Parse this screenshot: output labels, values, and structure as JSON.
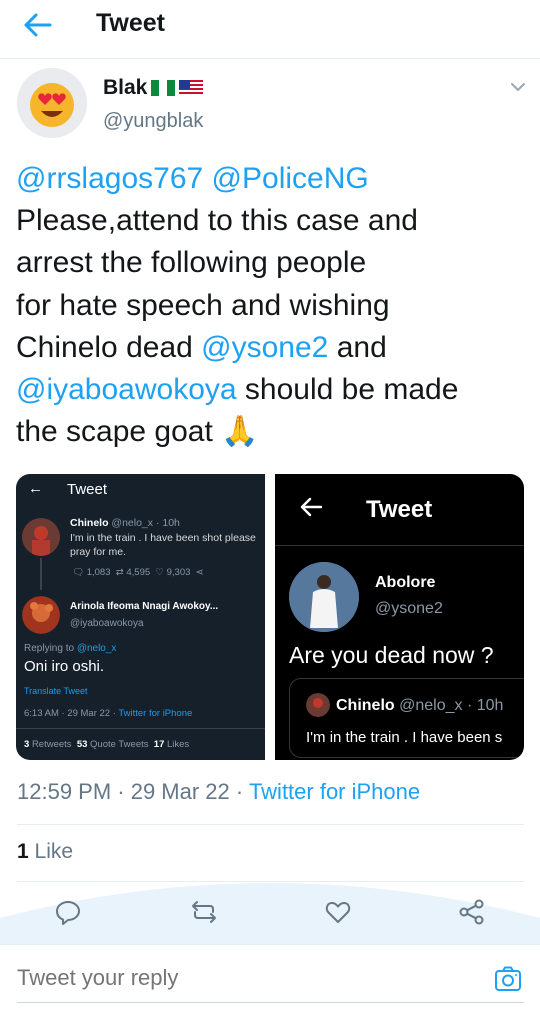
{
  "header": {
    "title": "Tweet"
  },
  "author": {
    "name": "Blak",
    "handle": "@yungblak",
    "avatar_emoji": "😍"
  },
  "tweet": {
    "lines": [
      [
        {
          "t": "@rrslagos767 @PoliceNG",
          "m": true
        }
      ],
      [
        {
          "t": "Please,attend to this case and",
          "m": false
        }
      ],
      [
        {
          "t": "arrest the following  people",
          "m": false
        }
      ],
      [
        {
          "t": "for hate speech and wishing",
          "m": false
        }
      ],
      [
        {
          "t": "Chinelo dead ",
          "m": false
        },
        {
          "t": "@ysone2",
          "m": true
        },
        {
          "t": " and",
          "m": false
        }
      ],
      [
        {
          "t": "@iyaboawokoya",
          "m": true
        },
        {
          "t": " should be made",
          "m": false
        }
      ],
      [
        {
          "t": "the scape goat ",
          "m": false
        },
        {
          "t": "🙏",
          "m": false
        }
      ]
    ]
  },
  "media_left": {
    "title": "Tweet",
    "original": {
      "name": "Chinelo",
      "handle": "@nelo_x",
      "age": "10h",
      "text_line1": "I'm in the train .  I have been shot please",
      "text_line2": "pray for me.",
      "replies": "1,083",
      "retweets": "4,595",
      "likes": "9,303"
    },
    "reply": {
      "name": "Arinola Ifeoma Nnagi Awokoy...",
      "handle": "@iyaboawokoya",
      "replying_to_label": "Replying to",
      "replying_to_handle": "@nelo_x",
      "text": "Oni iro oshi.",
      "translate": "Translate Tweet",
      "timestamp": "6:13 AM · 29 Mar 22",
      "source": "Twitter for iPhone",
      "stat_retweets_num": "3",
      "stat_retweets_label": "Retweets",
      "stat_quotes_num": "53",
      "stat_quotes_label": "Quote Tweets",
      "stat_likes_num": "17",
      "stat_likes_label": "Likes"
    }
  },
  "media_right": {
    "title": "Tweet",
    "name": "Abolore",
    "handle": "@ysone2",
    "text": "Are you dead now ?",
    "quoted": {
      "name": "Chinelo",
      "handle_age": "@nelo_x · 10h",
      "text": "I'm in the train .  I have been s"
    }
  },
  "meta": {
    "time_date": "12:59 PM · 29 Mar 22 · ",
    "source": "Twitter for iPhone",
    "likes_count": "1",
    "likes_label": "Like"
  },
  "reply": {
    "placeholder": "Tweet your reply"
  },
  "colors": {
    "accent": "#1da1f2",
    "muted": "#657786",
    "text": "#14171a"
  }
}
